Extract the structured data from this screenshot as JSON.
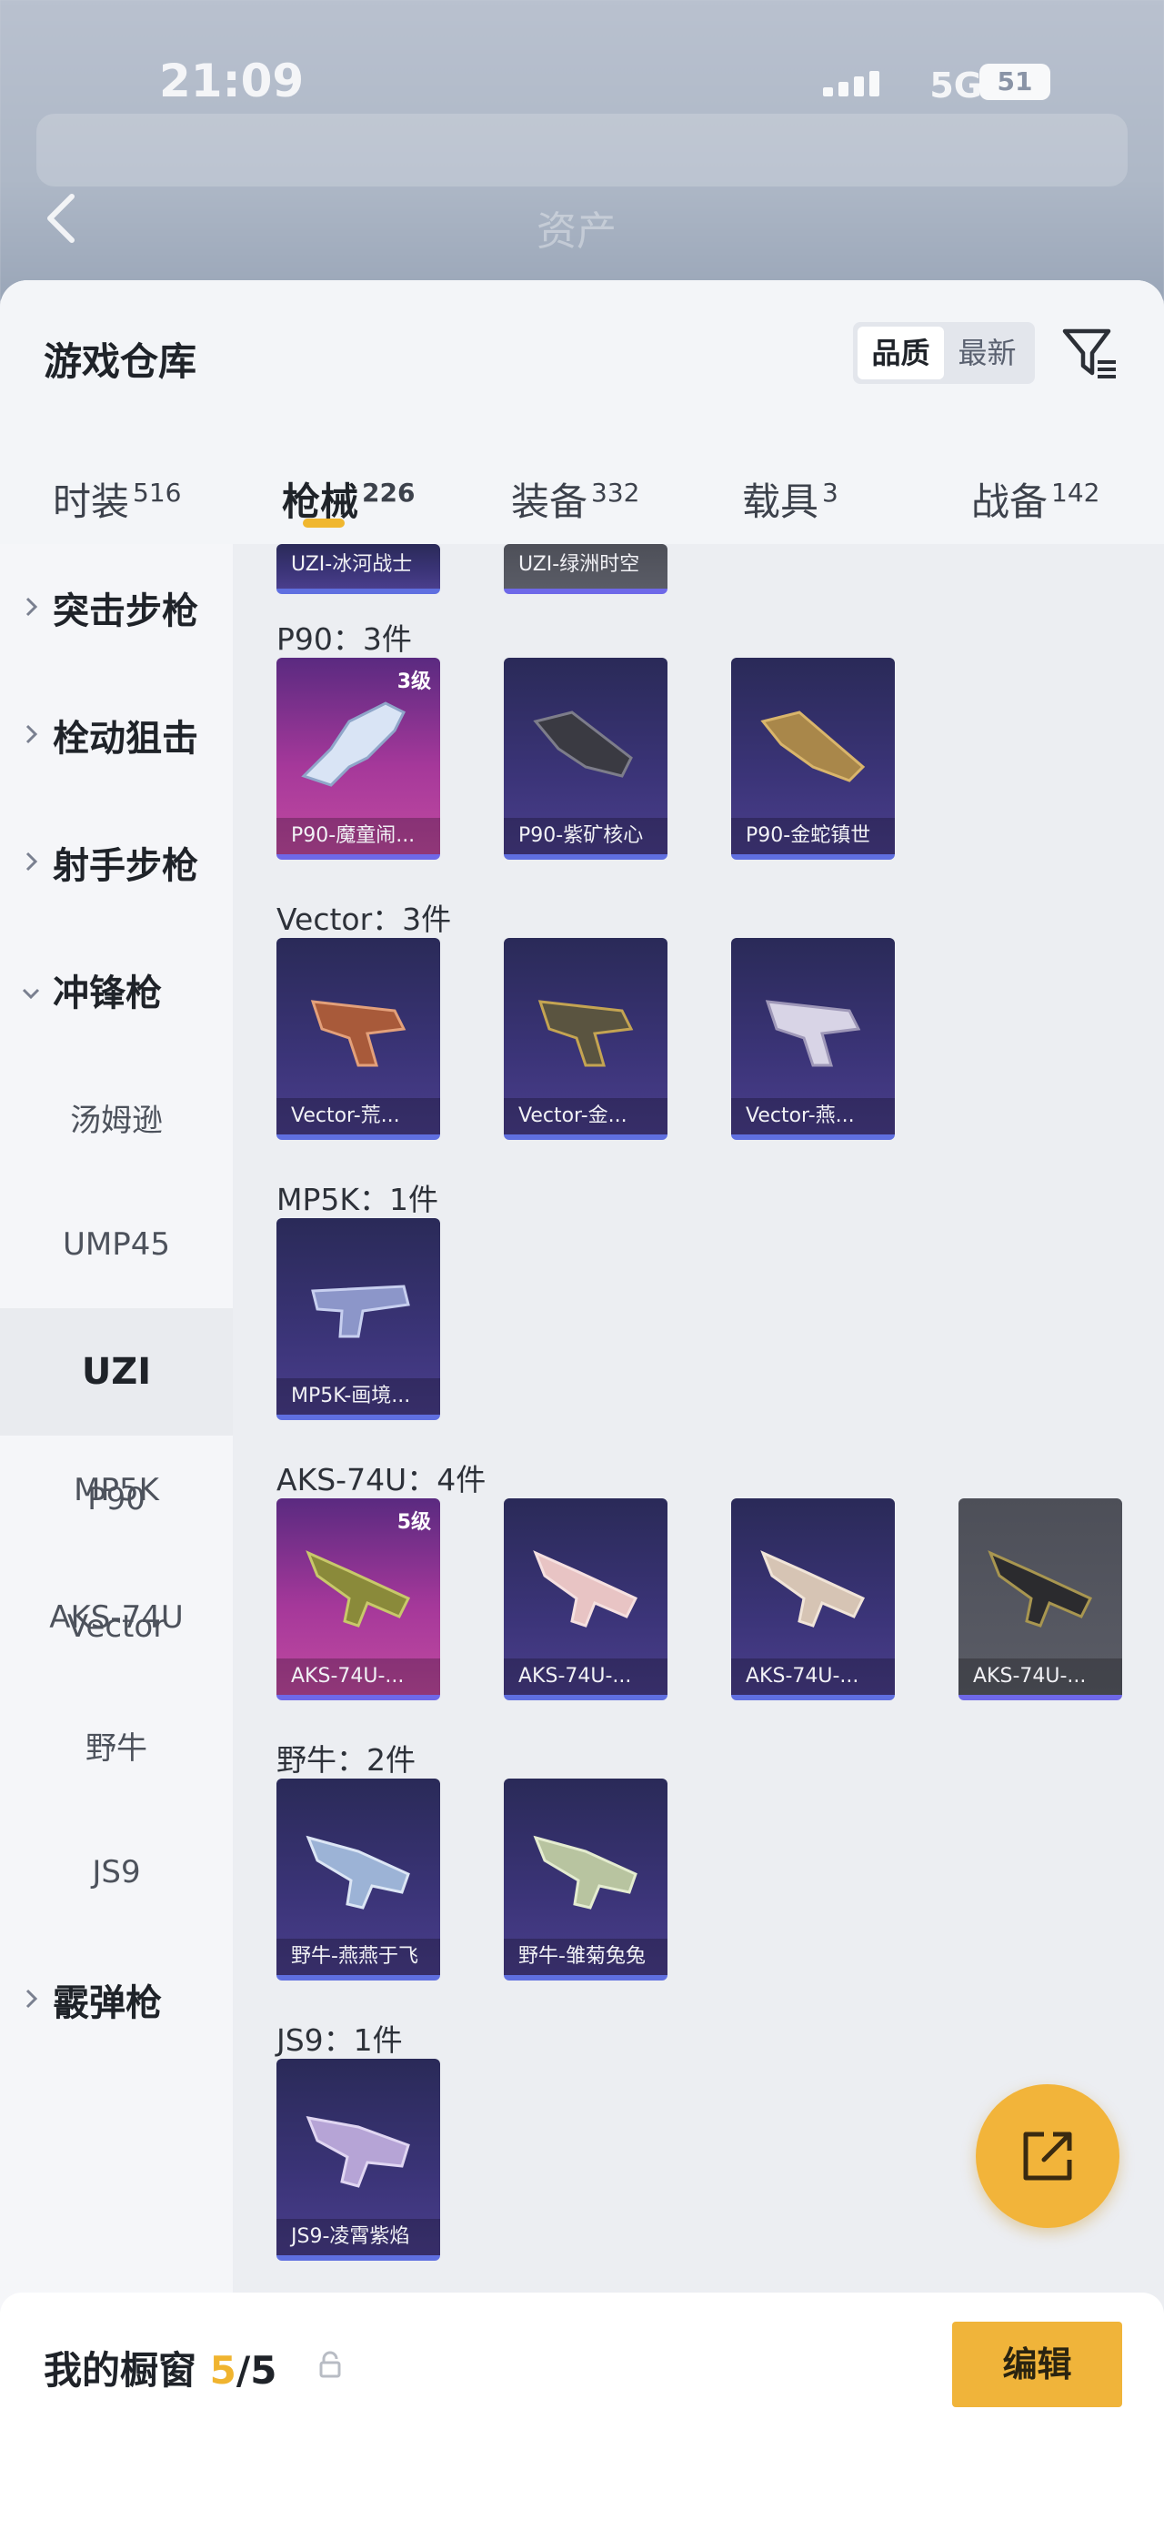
{
  "status_bar": {
    "time": "21:09",
    "network": "5G",
    "battery": "51"
  },
  "background_header": {
    "ghost_text_1": "资产"
  },
  "header": {
    "title": "游戏仓库",
    "sort_options": [
      "品质",
      "最新"
    ],
    "sort_selected": "品质"
  },
  "tabs": [
    {
      "label": "时装",
      "count": "516"
    },
    {
      "label": "枪械",
      "count": "226"
    },
    {
      "label": "装备",
      "count": "332"
    },
    {
      "label": "载具",
      "count": "3"
    },
    {
      "label": "战备",
      "count": "142"
    }
  ],
  "active_tab": "枪械",
  "sidebar": {
    "items": [
      {
        "label": "突击步枪",
        "type": "category",
        "expanded": false
      },
      {
        "label": "栓动狙击",
        "type": "category",
        "expanded": false
      },
      {
        "label": "射手步枪",
        "type": "category",
        "expanded": false
      },
      {
        "label": "冲锋枪",
        "type": "category",
        "expanded": true
      },
      {
        "label": "汤姆逊",
        "type": "sub"
      },
      {
        "label": "UMP45",
        "type": "sub"
      },
      {
        "label": "UZI",
        "type": "sub",
        "selected": true
      },
      {
        "label": "P90",
        "type": "sub"
      },
      {
        "label": "Vector",
        "type": "sub"
      },
      {
        "label": "MP5K",
        "type": "sub"
      },
      {
        "label": "AKS-74U",
        "type": "sub"
      },
      {
        "label": "野牛",
        "type": "sub"
      },
      {
        "label": "JS9",
        "type": "sub"
      },
      {
        "label": "霰弹枪",
        "type": "category",
        "expanded": false
      }
    ]
  },
  "content": {
    "partial_row": [
      {
        "name": "UZI-冰河战士"
      },
      {
        "name": "UZI-绿洲时空"
      }
    ],
    "groups": [
      {
        "label": "P90：3件",
        "items": [
          {
            "name": "P90-魔童闹...",
            "level": "3级",
            "rarity": "gold"
          },
          {
            "name": "P90-紫矿核心",
            "rarity": "purple"
          },
          {
            "name": "P90-金蛇镇世",
            "rarity": "purple"
          }
        ]
      },
      {
        "label": "Vector：3件",
        "items": [
          {
            "name": "Vector-荒...",
            "rarity": "purple"
          },
          {
            "name": "Vector-金...",
            "rarity": "purple"
          },
          {
            "name": "Vector-燕...",
            "rarity": "purple"
          }
        ]
      },
      {
        "label": "MP5K：1件",
        "items": [
          {
            "name": "MP5K-画境...",
            "rarity": "purple"
          }
        ]
      },
      {
        "label": "AKS-74U：4件",
        "items": [
          {
            "name": "AKS-74U-...",
            "level": "5级",
            "rarity": "gold"
          },
          {
            "name": "AKS-74U-...",
            "rarity": "purple"
          },
          {
            "name": "AKS-74U-...",
            "rarity": "purple"
          },
          {
            "name": "AKS-74U-...",
            "rarity": "grey"
          }
        ]
      },
      {
        "label": "野牛：2件",
        "items": [
          {
            "name": "野牛-燕燕于飞",
            "rarity": "purple"
          },
          {
            "name": "野牛-雏菊兔兔",
            "rarity": "purple"
          }
        ]
      },
      {
        "label": "JS9：1件",
        "items": [
          {
            "name": "JS9-凌霄紫焰",
            "rarity": "purple"
          }
        ]
      }
    ]
  },
  "bottom_bar": {
    "label": "我的橱窗",
    "current": "5",
    "separator": "/",
    "total": "5",
    "edit_label": "编辑"
  },
  "colors": {
    "accent": "#f0b43a",
    "card_purple": "#3b3478",
    "card_gold": "#a5389a",
    "card_grey": "#55575f"
  },
  "icons": [
    "back-arrow-icon",
    "filter-icon",
    "chevron-right-icon",
    "chevron-down-icon",
    "lock-icon",
    "share-icon"
  ]
}
